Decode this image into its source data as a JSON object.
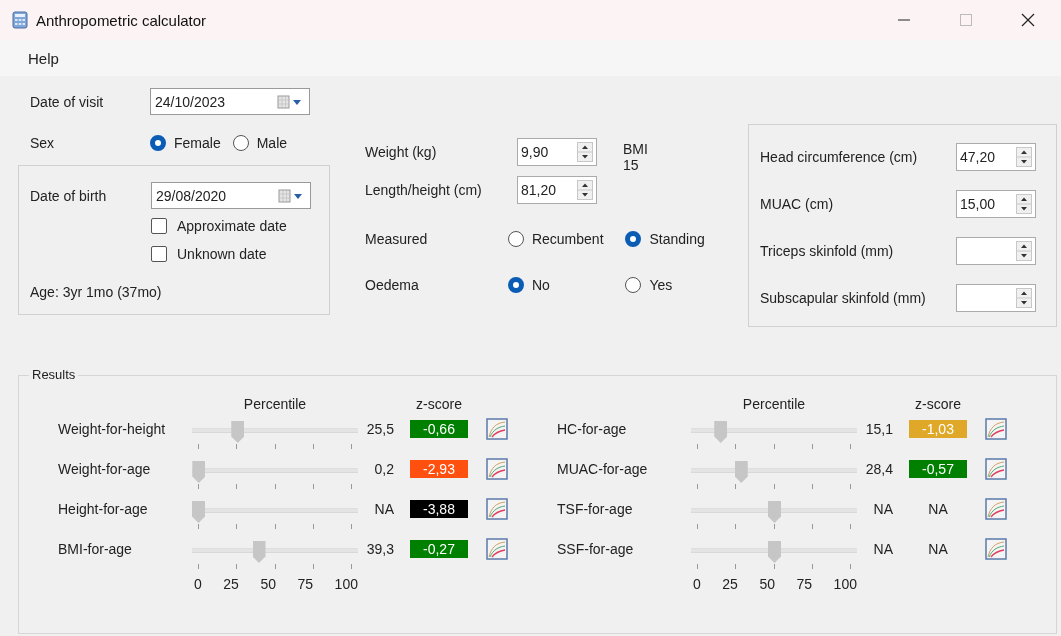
{
  "window": {
    "title": "Anthropometric calculator"
  },
  "menu": [
    {
      "label": "Help"
    }
  ],
  "visit": {
    "label": "Date of visit",
    "value": "24/10/2023"
  },
  "sex": {
    "label": "Sex",
    "options": [
      {
        "label": "Female",
        "selected": true
      },
      {
        "label": "Male",
        "selected": false
      }
    ]
  },
  "birth": {
    "label": "Date of birth",
    "value": "29/08/2020",
    "checks": [
      {
        "label": "Approximate date",
        "checked": false
      },
      {
        "label": "Unknown date",
        "checked": false
      }
    ],
    "age": "Age: 3yr 1mo (37mo)"
  },
  "measures": [
    {
      "label": "Weight (kg)",
      "value": "9,90"
    },
    {
      "label": "Length/height (cm)",
      "value": "81,20"
    }
  ],
  "bmi": {
    "label": "BMI",
    "value": "15"
  },
  "measured": {
    "label": "Measured",
    "options": [
      {
        "label": "Recumbent",
        "selected": false
      },
      {
        "label": "Standing",
        "selected": true
      }
    ]
  },
  "oedema": {
    "label": "Oedema",
    "options": [
      {
        "label": "No",
        "selected": true
      },
      {
        "label": "Yes",
        "selected": false
      }
    ]
  },
  "extra": [
    {
      "label": "Head circumference (cm)",
      "value": "47,20"
    },
    {
      "label": "MUAC (cm)",
      "value": "15,00"
    },
    {
      "label": "Triceps skinfold (mm)"
    },
    {
      "label": "Subscapular skinfold (mm)"
    }
  ],
  "results": {
    "title": "Results",
    "panels": [
      {
        "percentile_header": "Percentile",
        "zscore_header": "z-score",
        "ticks": [
          "0",
          "25",
          "50",
          "75",
          "100"
        ],
        "rows": [
          {
            "name": "Weight-for-height",
            "level": 0.255,
            "percentile": "25,5",
            "zscore": "-0,66",
            "color": "#008000"
          },
          {
            "name": "Weight-for-age",
            "level": 0.002,
            "percentile": "0,2",
            "zscore": "-2,93",
            "color": "#ff5010"
          },
          {
            "name": "Height-for-age",
            "level": 0,
            "percentile": "NA",
            "zscore": "-3,88",
            "color": "#000000"
          },
          {
            "name": "BMI-for-age",
            "level": 0.393,
            "percentile": "39,3",
            "zscore": "-0,27",
            "color": "#008000"
          }
        ]
      },
      {
        "percentile_header": "Percentile",
        "zscore_header": "z-score",
        "ticks": [
          "0",
          "25",
          "50",
          "75",
          "100"
        ],
        "rows": [
          {
            "name": "HC-for-age",
            "level": 0.151,
            "percentile": "15,1",
            "zscore": "-1,03",
            "color": "#e0a828"
          },
          {
            "name": "MUAC-for-age",
            "level": 0.284,
            "percentile": "28,4",
            "zscore": "-0,57",
            "color": "#008000"
          },
          {
            "name": "TSF-for-age",
            "level": 0.5,
            "percentile": "NA",
            "zscore": "NA"
          },
          {
            "name": "SSF-for-age",
            "level": 0.5,
            "percentile": "NA",
            "zscore": "NA"
          }
        ]
      }
    ]
  }
}
